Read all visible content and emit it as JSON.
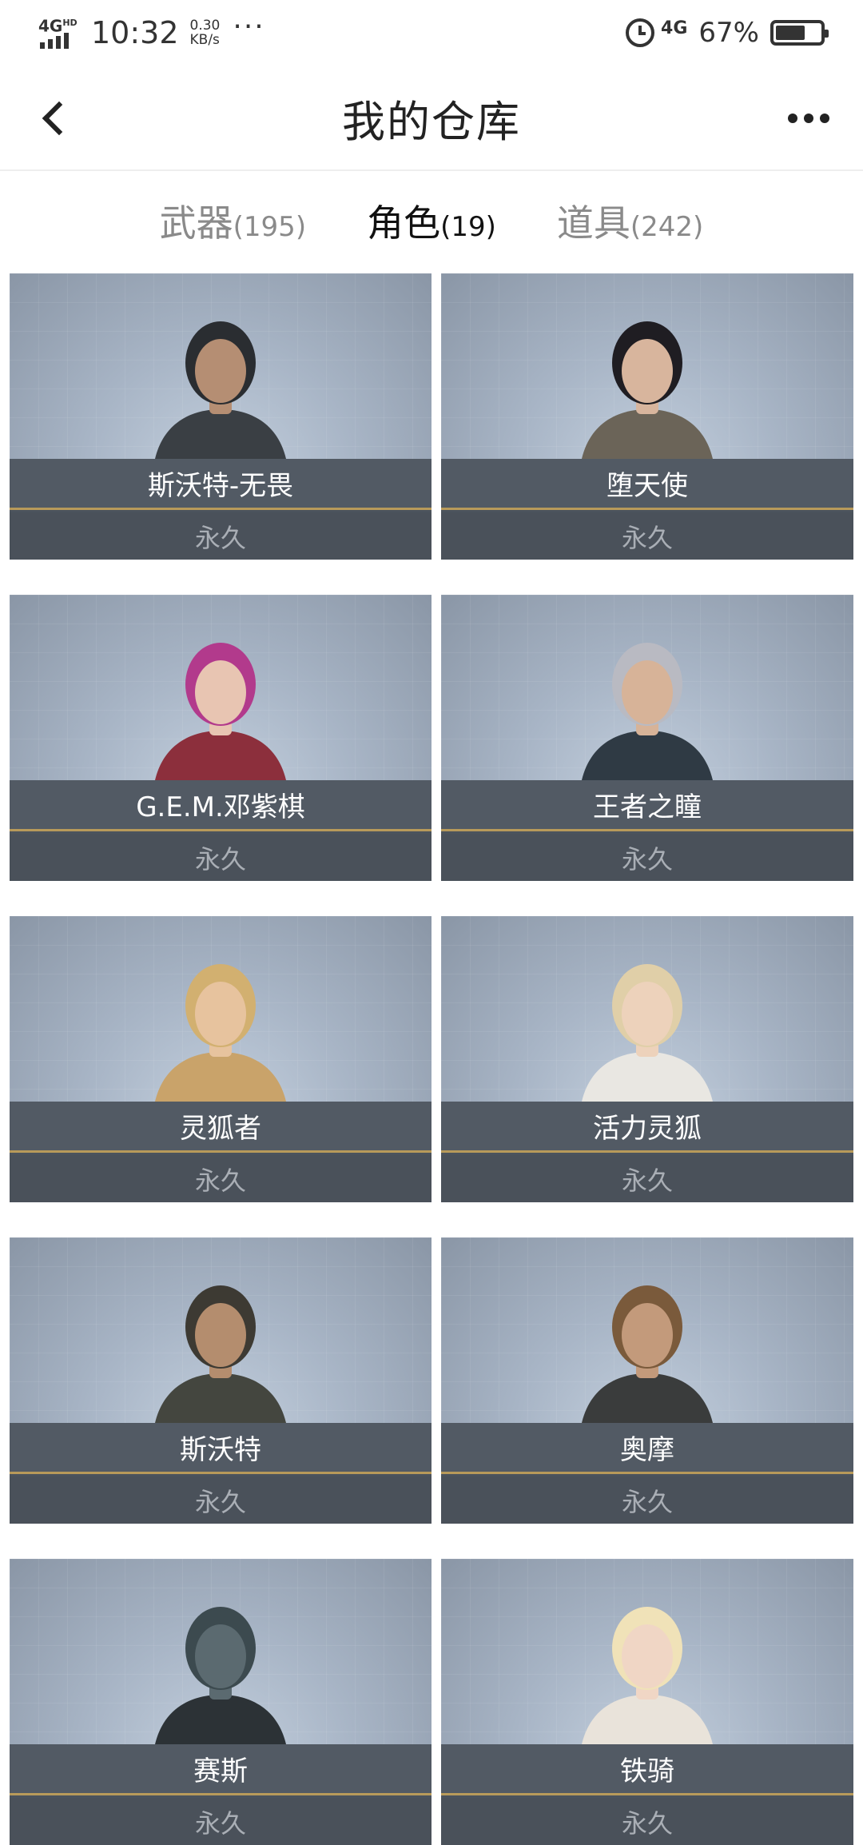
{
  "status_bar": {
    "network": "4G",
    "network_hd": "HD",
    "time": "10:32",
    "speed_value": "0.30",
    "speed_unit": "KB/s",
    "dots": "···",
    "net_right": "4G",
    "battery": "67%"
  },
  "header": {
    "title": "我的仓库"
  },
  "tabs": [
    {
      "label": "武器",
      "count": "(195)"
    },
    {
      "label": "角色",
      "count": "(19)"
    },
    {
      "label": "道具",
      "count": "(242)"
    }
  ],
  "active_tab": 1,
  "cards": [
    {
      "name": "斯沃特-无畏",
      "duration": "永久",
      "avatar": "soldier-helmet-avatar",
      "hair": "#2a2d31",
      "skin": "#b58e73",
      "outfit": "#3a3f44"
    },
    {
      "name": "堕天使",
      "duration": "永久",
      "avatar": "dark-angel-avatar",
      "hair": "#1f1d22",
      "skin": "#d8b59d",
      "outfit": "#6b6458"
    },
    {
      "name": "G.E.M.邓紫棋",
      "duration": "永久",
      "avatar": "pink-hair-girl-avatar",
      "hair": "#b23a8c",
      "skin": "#e8c5b2",
      "outfit": "#8c2f3c"
    },
    {
      "name": "王者之瞳",
      "duration": "永久",
      "avatar": "silver-hair-man-avatar",
      "hair": "#b9bac2",
      "skin": "#d7b398",
      "outfit": "#2f3a44"
    },
    {
      "name": "灵狐者",
      "duration": "永久",
      "avatar": "cap-girl-avatar",
      "hair": "#d2b070",
      "skin": "#e7c39e",
      "outfit": "#c9a36a"
    },
    {
      "name": "活力灵狐",
      "duration": "永久",
      "avatar": "red-cap-girl-avatar",
      "hair": "#e0cfa8",
      "skin": "#edd2bb",
      "outfit": "#e9e7e2"
    },
    {
      "name": "斯沃特",
      "duration": "永久",
      "avatar": "headset-soldier-avatar",
      "hair": "#3d3a33",
      "skin": "#b48d6e",
      "outfit": "#44463f"
    },
    {
      "name": "奥摩",
      "duration": "永久",
      "avatar": "beanie-man-avatar",
      "hair": "#7a5a3b",
      "skin": "#c39a7b",
      "outfit": "#3a3c3c"
    },
    {
      "name": "赛斯",
      "duration": "永久",
      "avatar": "gas-mask-avatar",
      "hair": "#3c4a4f",
      "skin": "#5b6a70",
      "outfit": "#2c3236"
    },
    {
      "name": "铁骑",
      "duration": "永久",
      "avatar": "officer-hat-girl-avatar",
      "hair": "#f0e2b8",
      "skin": "#f0d6c5",
      "outfit": "#e9e3da"
    }
  ]
}
